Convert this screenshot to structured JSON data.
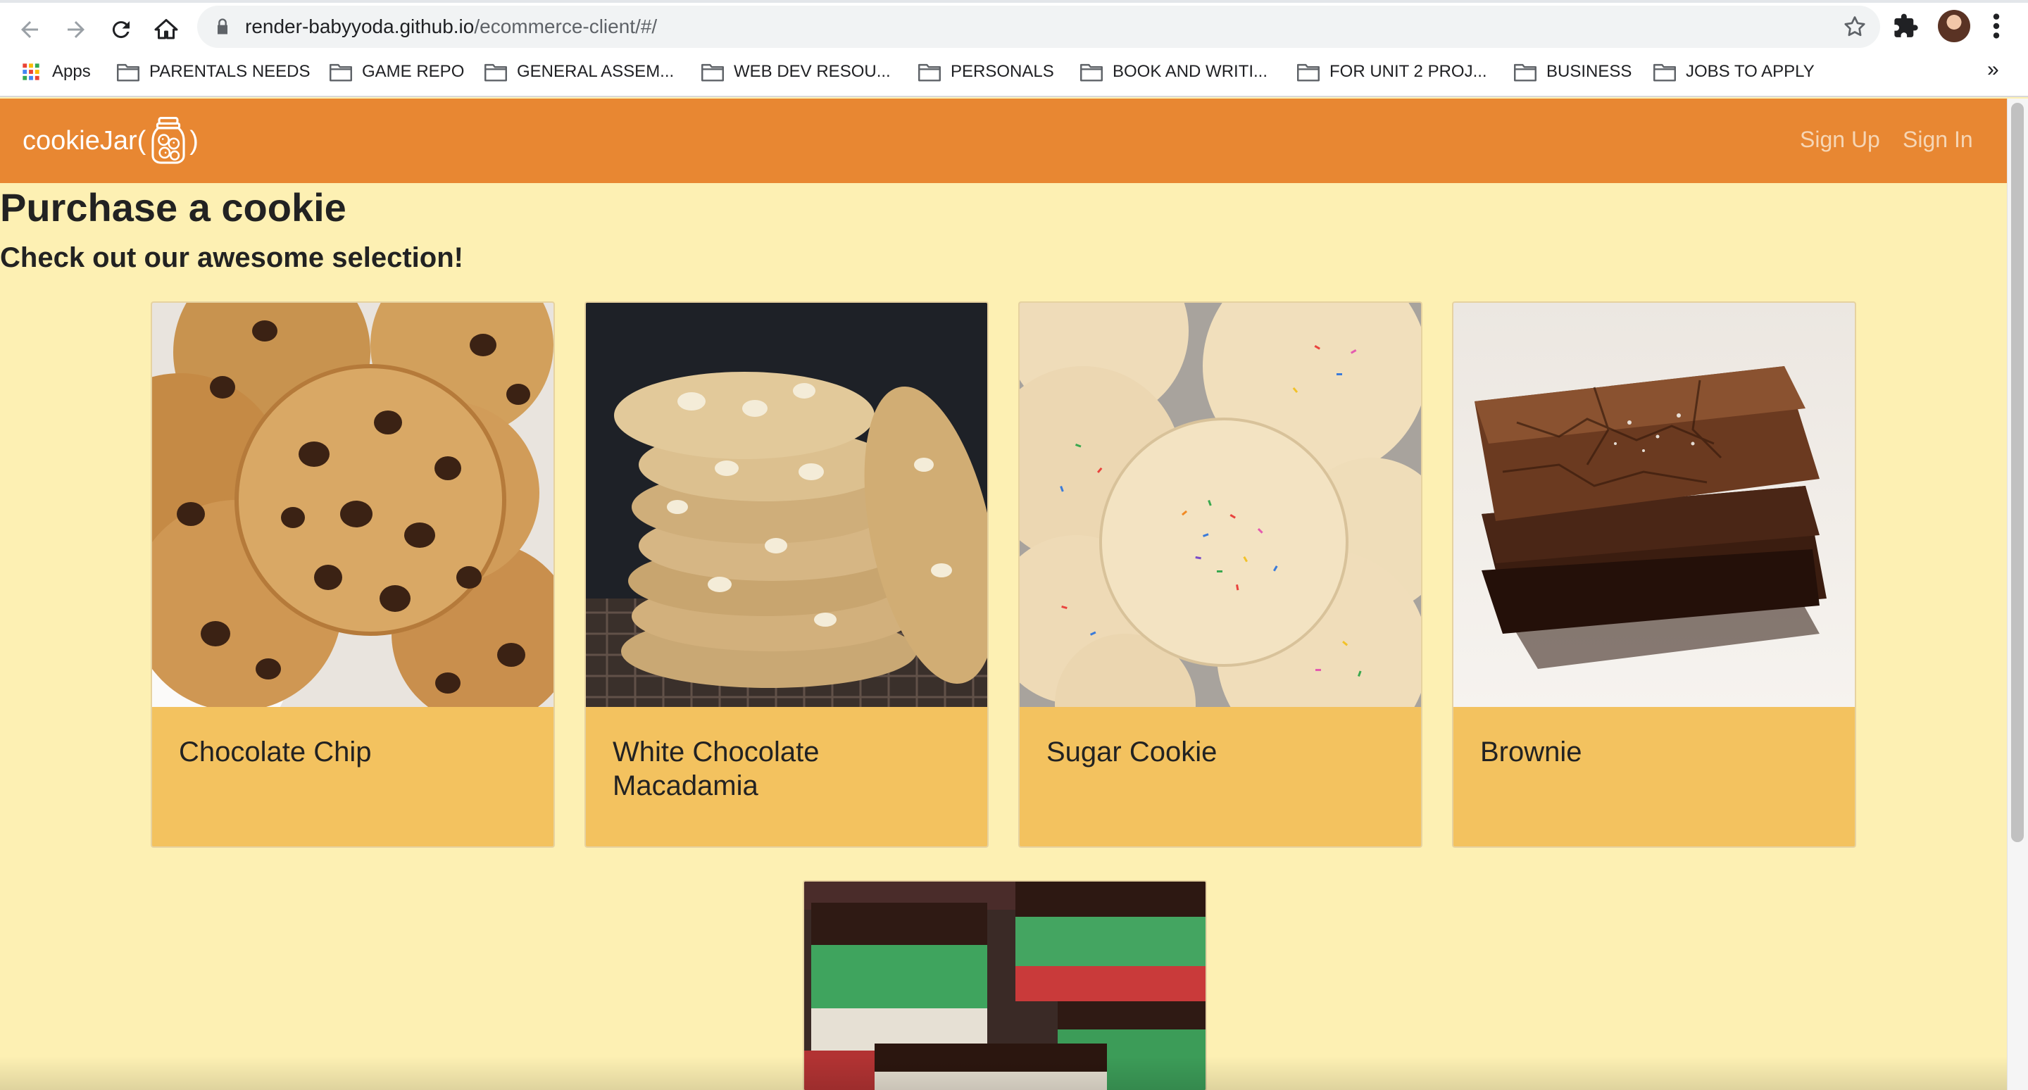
{
  "browser": {
    "url_host": "render-babyyoda.github.io",
    "url_path": "/ecommerce-client/#/",
    "bookmarks": [
      {
        "label": "Apps",
        "icon": "apps-grid-icon"
      },
      {
        "label": "PARENTALS NEEDS",
        "icon": "folder-icon"
      },
      {
        "label": "GAME REPO",
        "icon": "folder-icon"
      },
      {
        "label": "GENERAL ASSEM...",
        "icon": "folder-icon"
      },
      {
        "label": "WEB DEV RESOU...",
        "icon": "folder-icon"
      },
      {
        "label": "PERSONALS",
        "icon": "folder-icon"
      },
      {
        "label": "BOOK AND WRITI...",
        "icon": "folder-icon"
      },
      {
        "label": "FOR UNIT 2 PROJ...",
        "icon": "folder-icon"
      },
      {
        "label": "BUSINESS",
        "icon": "folder-icon"
      },
      {
        "label": "JOBS TO APPLY",
        "icon": "folder-icon"
      }
    ],
    "bookmarks_overflow": "»"
  },
  "app": {
    "brand_prefix": "cookieJar(",
    "brand_suffix": ")",
    "brand_icon": "cookie-jar-icon",
    "nav": {
      "sign_up": "Sign Up",
      "sign_in": "Sign In"
    },
    "colors": {
      "navbar": "#e88732",
      "background": "#fdf0b3",
      "card": "#f3c25f"
    }
  },
  "main": {
    "title": "Purchase a cookie",
    "subtitle": "Check out our awesome selection!",
    "products": [
      {
        "name": "Chocolate Chip",
        "image": "chocolate-chip-cookie-photo"
      },
      {
        "name": "White Chocolate Macadamia",
        "image": "white-chocolate-macadamia-photo"
      },
      {
        "name": "Sugar Cookie",
        "image": "sugar-cookie-photo"
      },
      {
        "name": "Brownie",
        "image": "brownie-photo"
      },
      {
        "name": "",
        "image": "rainbow-cookie-photo"
      }
    ]
  }
}
